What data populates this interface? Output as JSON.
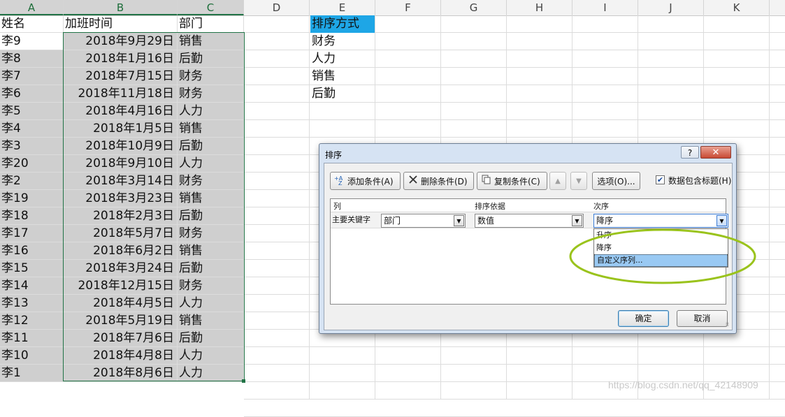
{
  "sheet": {
    "columns": [
      "A",
      "B",
      "C",
      "D",
      "E",
      "F",
      "G",
      "H",
      "I",
      "J",
      "K"
    ],
    "header_row": {
      "name": "姓名",
      "date": "加班时间",
      "dept": "部门"
    },
    "rows": [
      {
        "name": "李9",
        "date": "2018年9月29日",
        "dept": "销售"
      },
      {
        "name": "李8",
        "date": "2018年1月16日",
        "dept": "后勤"
      },
      {
        "name": "李7",
        "date": "2018年7月15日",
        "dept": "财务"
      },
      {
        "name": "李6",
        "date": "2018年11月18日",
        "dept": "财务"
      },
      {
        "name": "李5",
        "date": "2018年4月16日",
        "dept": "人力"
      },
      {
        "name": "李4",
        "date": "2018年1月5日",
        "dept": "销售"
      },
      {
        "name": "李3",
        "date": "2018年10月9日",
        "dept": "后勤"
      },
      {
        "name": "李20",
        "date": "2018年9月10日",
        "dept": "人力"
      },
      {
        "name": "李2",
        "date": "2018年3月14日",
        "dept": "财务"
      },
      {
        "name": "李19",
        "date": "2018年3月23日",
        "dept": "销售"
      },
      {
        "name": "李18",
        "date": "2018年2月3日",
        "dept": "后勤"
      },
      {
        "name": "李17",
        "date": "2018年5月7日",
        "dept": "财务"
      },
      {
        "name": "李16",
        "date": "2018年6月2日",
        "dept": "销售"
      },
      {
        "name": "李15",
        "date": "2018年3月24日",
        "dept": "后勤"
      },
      {
        "name": "李14",
        "date": "2018年12月15日",
        "dept": "财务"
      },
      {
        "name": "李13",
        "date": "2018年4月5日",
        "dept": "人力"
      },
      {
        "name": "李12",
        "date": "2018年5月19日",
        "dept": "销售"
      },
      {
        "name": "李11",
        "date": "2018年7月6日",
        "dept": "后勤"
      },
      {
        "name": "李10",
        "date": "2018年4月8日",
        "dept": "人力"
      },
      {
        "name": "李1",
        "date": "2018年8月6日",
        "dept": "人力"
      }
    ],
    "sort_list": {
      "header": "排序方式",
      "items": [
        "财务",
        "人力",
        "销售",
        "后勤"
      ]
    },
    "accent_header_color": "#1ea6e6",
    "selection_color": "#217346"
  },
  "dialog": {
    "title": "排序",
    "help_label": "?",
    "close_label": "✕",
    "toolbar": {
      "add_label": "添加条件(A)",
      "delete_label": "删除条件(D)",
      "copy_label": "复制条件(C)",
      "up_label": "▲",
      "down_label": "▼",
      "options_label": "选项(O)...",
      "has_header_label": "数据包含标题(H)",
      "has_header_checked": true
    },
    "grid_headers": {
      "column": "列",
      "sort_on": "排序依据",
      "order": "次序"
    },
    "key_row": {
      "label": "主要关键字",
      "column_value": "部门",
      "sort_on_value": "数值",
      "order_value": "降序"
    },
    "order_options": [
      "升序",
      "降序",
      "自定义序列..."
    ],
    "order_highlighted": "自定义序列...",
    "ok_label": "确定",
    "cancel_label": "取消",
    "annotation_color": "#9ac31c"
  },
  "watermark": "https://blog.csdn.net/qq_42148909"
}
